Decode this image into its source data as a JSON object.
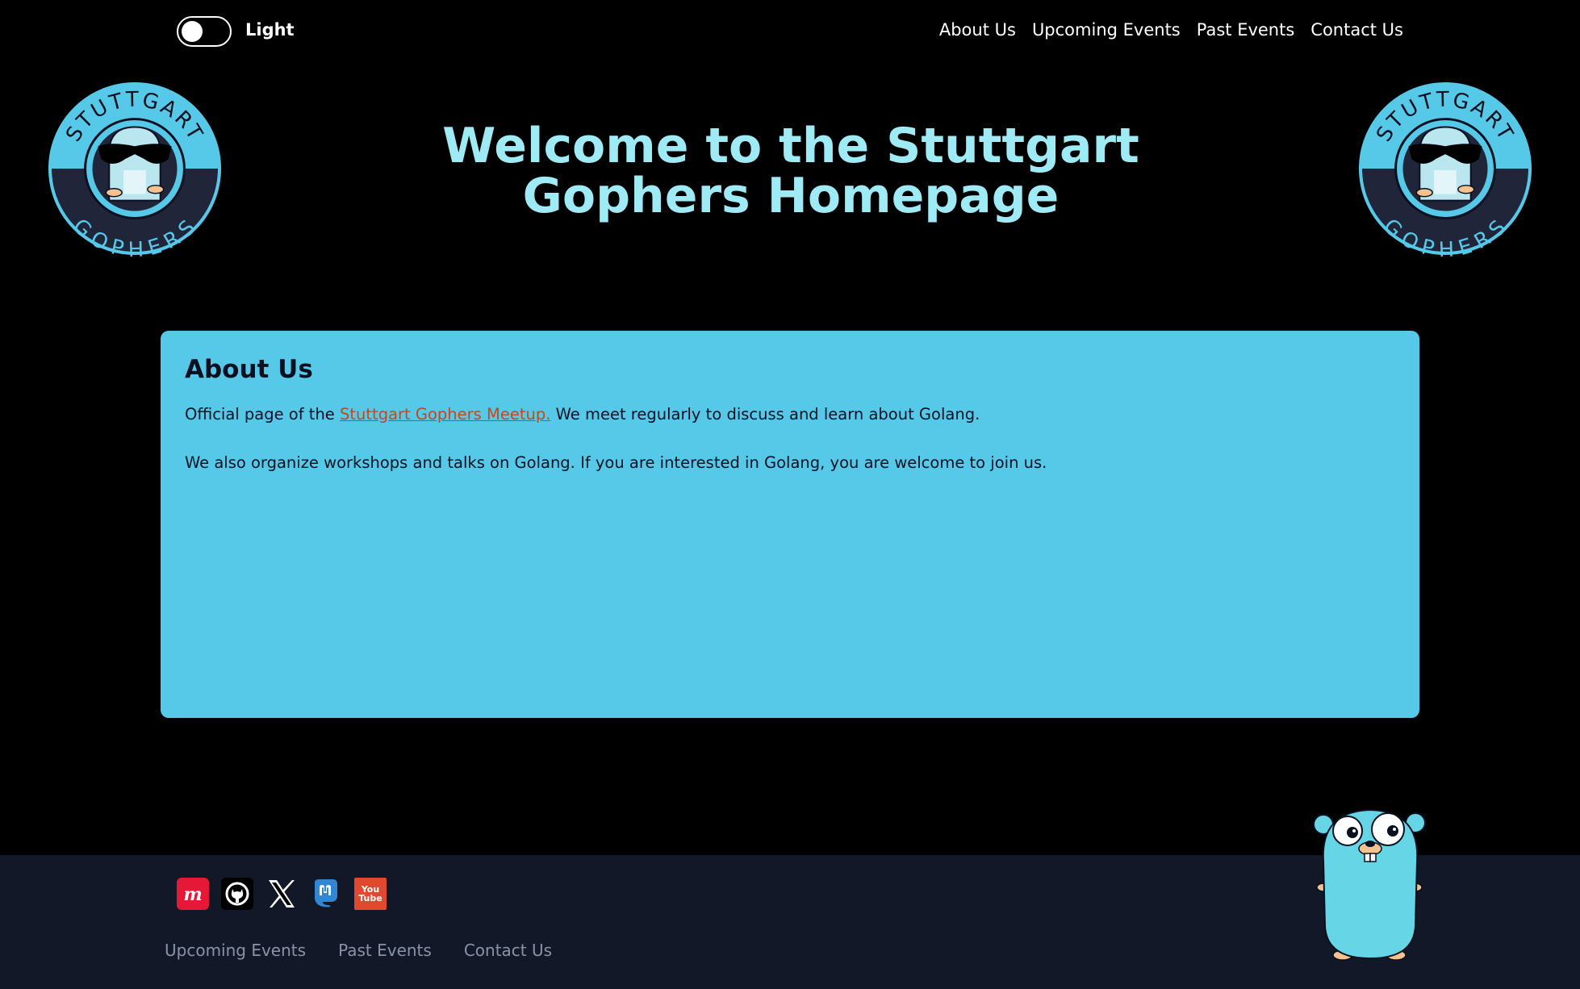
{
  "header": {
    "toggle_label": "Light",
    "nav": [
      "About Us",
      "Upcoming Events",
      "Past Events",
      "Contact Us"
    ]
  },
  "logo": {
    "top_text": "STUTTGART",
    "bottom_text": "GOPHERS"
  },
  "hero": {
    "title": "Welcome to the Stuttgart Gophers Homepage"
  },
  "about": {
    "heading": "About Us",
    "p1_before": "Official page of the ",
    "p1_link": "Stuttgart Gophers Meetup.",
    "p1_after": " We meet regularly to discuss and learn about Golang.",
    "p2": "We also organize workshops and talks on Golang. If you are interested in Golang, you are welcome to join us."
  },
  "footer": {
    "social_icons": [
      "meetup-icon",
      "github-icon",
      "x-icon",
      "mastodon-icon",
      "youtube-icon"
    ],
    "youtube_text": "You Tube",
    "links": [
      "Upcoming Events",
      "Past Events",
      "Contact Us"
    ]
  },
  "colors": {
    "background": "#000000",
    "hero_text": "#9eeaf5",
    "card": "#56c9e8",
    "link": "#c24a1a",
    "footer": "#121828"
  }
}
